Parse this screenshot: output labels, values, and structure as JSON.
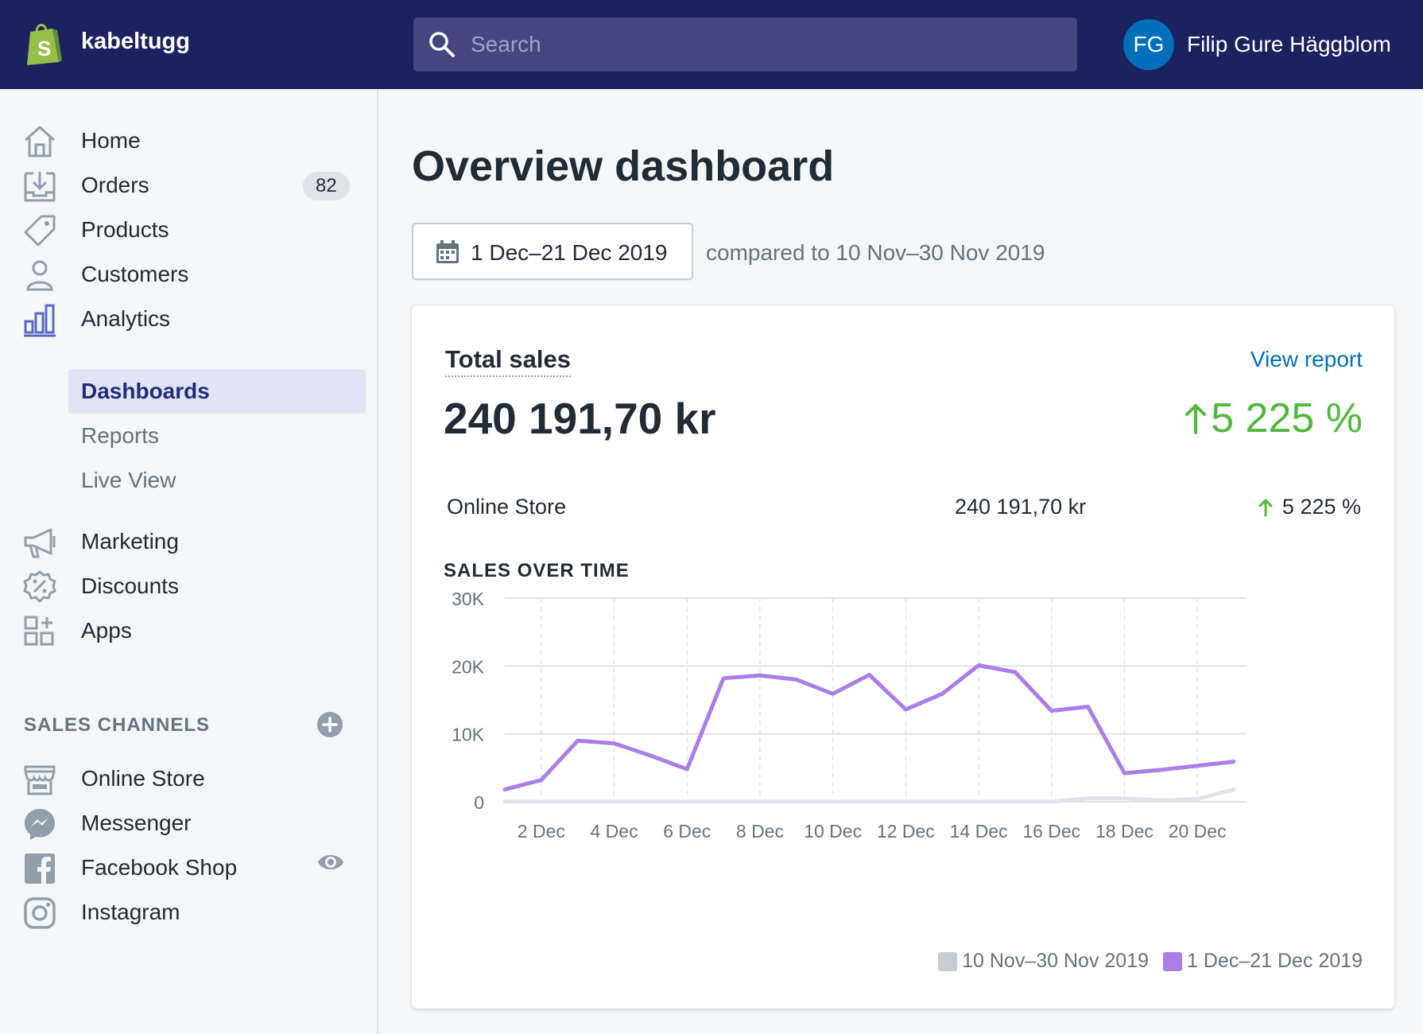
{
  "topbar": {
    "store_name": "kabeltugg",
    "search_placeholder": "Search",
    "user_initials": "FG",
    "user_name": "Filip Gure Häggblom"
  },
  "sidebar": {
    "items": [
      {
        "label": "Home",
        "icon": "home-icon"
      },
      {
        "label": "Orders",
        "icon": "orders-icon",
        "badge": "82"
      },
      {
        "label": "Products",
        "icon": "tag-icon"
      },
      {
        "label": "Customers",
        "icon": "person-icon"
      },
      {
        "label": "Analytics",
        "icon": "bar-chart-icon"
      }
    ],
    "analytics_sub": [
      {
        "label": "Dashboards",
        "active": true
      },
      {
        "label": "Reports"
      },
      {
        "label": "Live View"
      }
    ],
    "items2": [
      {
        "label": "Marketing",
        "icon": "megaphone-icon"
      },
      {
        "label": "Discounts",
        "icon": "discount-icon"
      },
      {
        "label": "Apps",
        "icon": "apps-icon"
      }
    ],
    "sales_channels_title": "SALES CHANNELS",
    "channels": [
      {
        "label": "Online Store",
        "icon": "store-icon"
      },
      {
        "label": "Messenger",
        "icon": "messenger-icon"
      },
      {
        "label": "Facebook Shop",
        "icon": "facebook-icon"
      },
      {
        "label": "Instagram",
        "icon": "instagram-icon"
      }
    ]
  },
  "main": {
    "page_title": "Overview dashboard",
    "date_range": "1 Dec–21 Dec 2019",
    "compared_text": "compared to 10 Nov–30 Nov 2019",
    "card": {
      "title": "Total sales",
      "view_report": "View report",
      "total": "240 191,70 kr",
      "total_change": "5 225 %",
      "row_label": "Online Store",
      "row_value": "240 191,70 kr",
      "row_change": "5 225 %",
      "chart_title": "SALES OVER TIME"
    }
  },
  "colors": {
    "accent": "#1c2260",
    "current_series": "#ab7de8",
    "previous_series": "#dfe3e8",
    "positive": "#50b83c",
    "link": "#006fbb"
  },
  "chart_data": {
    "type": "line",
    "title": "SALES OVER TIME",
    "x": [
      "1 Dec",
      "2 Dec",
      "3 Dec",
      "4 Dec",
      "5 Dec",
      "6 Dec",
      "7 Dec",
      "8 Dec",
      "9 Dec",
      "10 Dec",
      "11 Dec",
      "12 Dec",
      "13 Dec",
      "14 Dec",
      "15 Dec",
      "16 Dec",
      "17 Dec",
      "18 Dec",
      "19 Dec",
      "20 Dec",
      "21 Dec"
    ],
    "x_tick_labels": [
      "2 Dec",
      "4 Dec",
      "6 Dec",
      "8 Dec",
      "10 Dec",
      "12 Dec",
      "14 Dec",
      "16 Dec",
      "18 Dec",
      "20 Dec"
    ],
    "y_tick_labels": [
      "0",
      "10K",
      "20K",
      "30K"
    ],
    "ylim": [
      0,
      30000
    ],
    "grid": true,
    "legend_position": "bottom-right",
    "series": [
      {
        "name": "10 Nov–30 Nov 2019",
        "color": "#dfe3e8",
        "values": [
          0,
          0,
          0,
          0,
          0,
          0,
          0,
          0,
          0,
          0,
          0,
          0,
          0,
          0,
          0,
          0,
          500,
          500,
          200,
          400,
          1800
        ]
      },
      {
        "name": "1 Dec–21 Dec 2019",
        "color": "#ab7de8",
        "values": [
          1800,
          3200,
          9000,
          8600,
          6800,
          4800,
          18200,
          18600,
          18000,
          15900,
          18700,
          13600,
          15900,
          20100,
          19100,
          13400,
          14000,
          4200,
          4700,
          5300,
          5900
        ]
      }
    ]
  }
}
